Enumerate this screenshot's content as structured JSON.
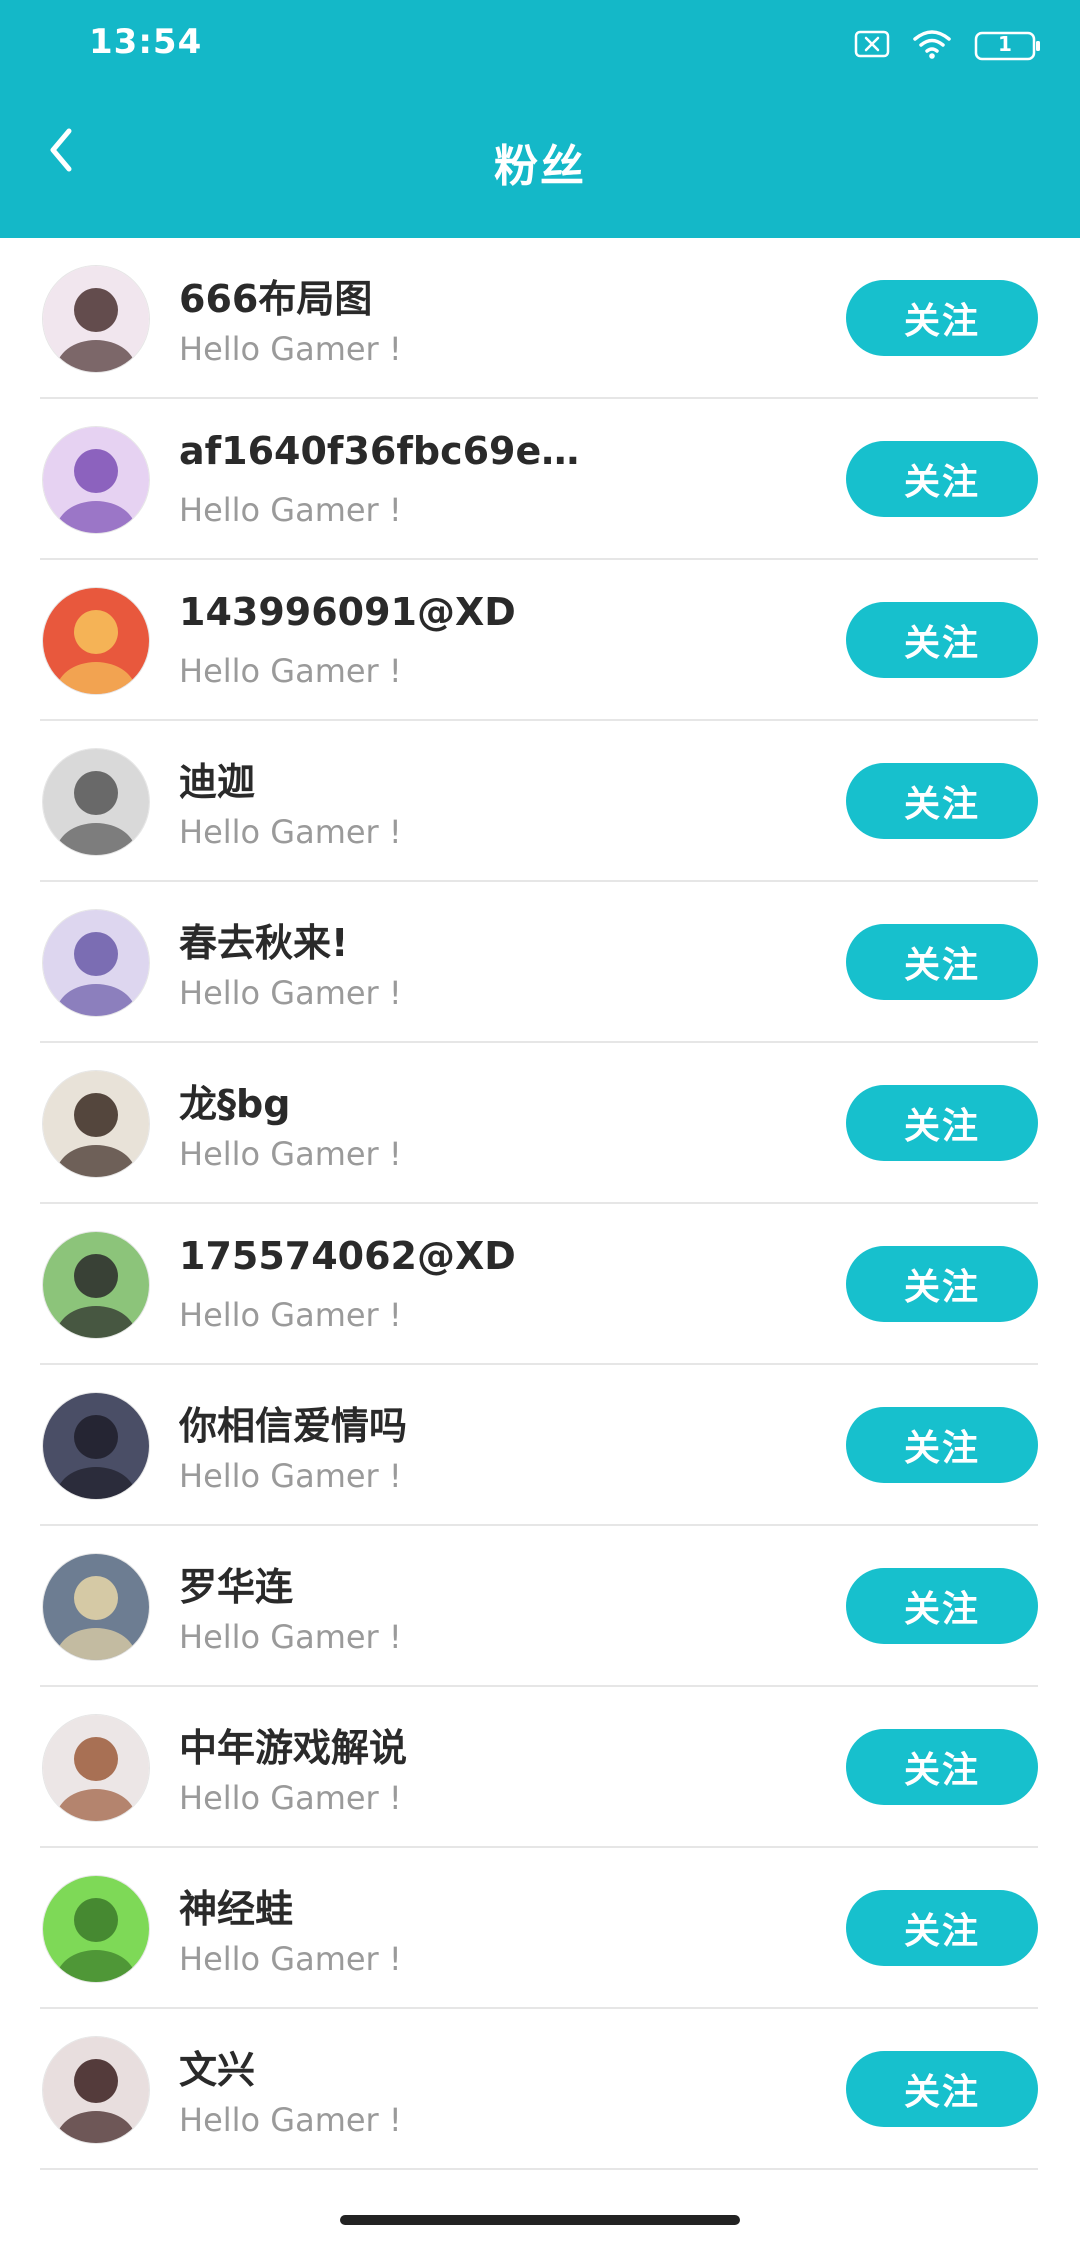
{
  "status_bar": {
    "time": "13:54",
    "battery_level": "1",
    "icons": [
      "sim-off-icon",
      "wifi-icon",
      "battery-icon"
    ]
  },
  "header": {
    "title": "粉丝",
    "back_icon": "chevron-left-icon"
  },
  "colors": {
    "header_bg": "#14b8c8",
    "button_bg": "#17c0cd",
    "name_text": "#2a2a2a",
    "subtitle_text": "#9a9a9a"
  },
  "followers": [
    {
      "name": "666布局图",
      "subtitle": "Hello Gamer !",
      "button": "关注",
      "avatar_bg": "#f1e6ee",
      "avatar_fg": "#4a3030"
    },
    {
      "name": "af1640f36fbc69e7...",
      "subtitle": "Hello Gamer !",
      "button": "关注",
      "avatar_bg": "#e6d2f2",
      "avatar_fg": "#7b4fb5"
    },
    {
      "name": "143996091@XD",
      "subtitle": "Hello Gamer !",
      "button": "关注",
      "avatar_bg": "#e8583d",
      "avatar_fg": "#f7c35a"
    },
    {
      "name": "迪迦",
      "subtitle": "Hello Gamer !",
      "button": "关注",
      "avatar_bg": "#d9d9d9",
      "avatar_fg": "#555555"
    },
    {
      "name": "春去秋来!",
      "subtitle": "Hello Gamer !",
      "button": "关注",
      "avatar_bg": "#ddd6ef",
      "avatar_fg": "#6a5aa8"
    },
    {
      "name": "龙§bg",
      "subtitle": "Hello Gamer !",
      "button": "关注",
      "avatar_bg": "#e8e2d8",
      "avatar_fg": "#3a2a22"
    },
    {
      "name": "175574062@XD",
      "subtitle": "Hello Gamer !",
      "button": "关注",
      "avatar_bg": "#8cc47a",
      "avatar_fg": "#2a2a2a"
    },
    {
      "name": "你相信爱情吗",
      "subtitle": "Hello Gamer !",
      "button": "关注",
      "avatar_bg": "#4a4e66",
      "avatar_fg": "#1e1e2a"
    },
    {
      "name": "罗华连",
      "subtitle": "Hello Gamer !",
      "button": "关注",
      "avatar_bg": "#6d7d92",
      "avatar_fg": "#e8d6a8"
    },
    {
      "name": "中年游戏解说",
      "subtitle": "Hello Gamer !",
      "button": "关注",
      "avatar_bg": "#ece6e6",
      "avatar_fg": "#9c5a3a"
    },
    {
      "name": "神经蛙",
      "subtitle": "Hello Gamer !",
      "button": "关注",
      "avatar_bg": "#7ed957",
      "avatar_fg": "#3c7a2a"
    },
    {
      "name": "文兴",
      "subtitle": "Hello Gamer !",
      "button": "关注",
      "avatar_bg": "#e8dede",
      "avatar_fg": "#3a1e1e"
    }
  ]
}
